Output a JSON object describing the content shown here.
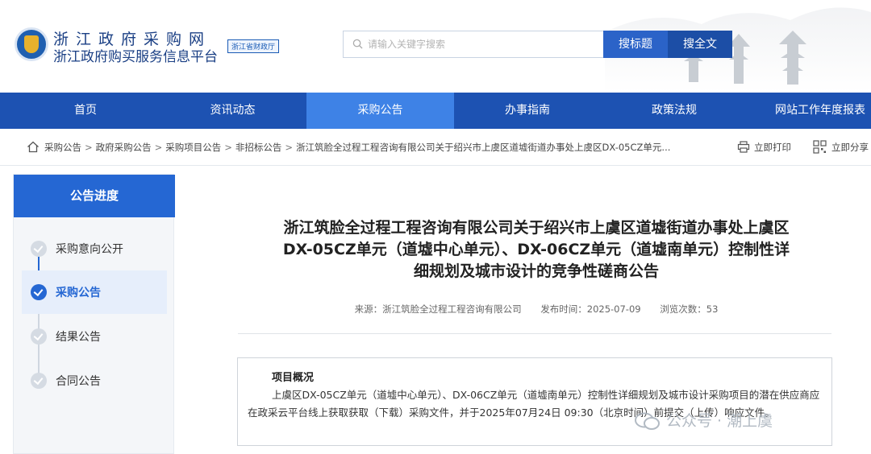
{
  "header": {
    "brand_line1": "浙江政府采购网",
    "brand_line2": "浙江政府购买服务信息平台",
    "dept_badge": "浙江省财政厅",
    "search_placeholder": "请输入关键字搜索",
    "search_title_button": "搜标题",
    "search_full_button": "搜全文"
  },
  "nav": {
    "items": [
      "首页",
      "资讯动态",
      "采购公告",
      "办事指南",
      "政策法规",
      "网站工作年度报表"
    ],
    "active_index": 2
  },
  "breadcrumb": {
    "items": [
      "采购公告",
      "政府采购公告",
      "采购项目公告",
      "非招标公告",
      "浙江筑脸全过程工程咨询有限公司关于绍兴市上虞区道墟街道办事处上虞区DX-05CZ单元..."
    ],
    "print_label": "立即打印",
    "share_label": "立即分享"
  },
  "sidebar": {
    "title": "公告进度",
    "steps": [
      {
        "label": "采购意向公开",
        "active": false
      },
      {
        "label": "采购公告",
        "active": true
      },
      {
        "label": "结果公告",
        "active": false
      },
      {
        "label": "合同公告",
        "active": false
      }
    ]
  },
  "article": {
    "title_line1": "浙江筑脸全过程工程咨询有限公司关于绍兴市上虞区道墟街道办事处上虞区",
    "title_line2": "DX-05CZ单元（道墟中心单元）、DX-06CZ单元（道墟南单元）控制性详",
    "title_line3": "细规划及城市设计的竞争性磋商公告",
    "source": "来源：浙江筑脸全过程工程咨询有限公司",
    "publish_time": "发布时间：2025-07-09",
    "views": "浏览次数：53",
    "overview_title": "项目概况",
    "overview_text": "上虞区DX-05CZ单元（道墟中心单元）、DX-06CZ单元（道墟南单元）控制性详细规划及城市设计采购项目的潜在供应商应在政采云平台线上获取获取（下载）采购文件，并于2025年07月24日 09:30（北京时间）前提交（上传）响应文件。"
  },
  "watermark": {
    "text": "公众号 · 潮上虞"
  },
  "colors": {
    "nav_bg": "#1d52b2",
    "nav_active": "#3e82e6",
    "accent": "#2567d3"
  }
}
